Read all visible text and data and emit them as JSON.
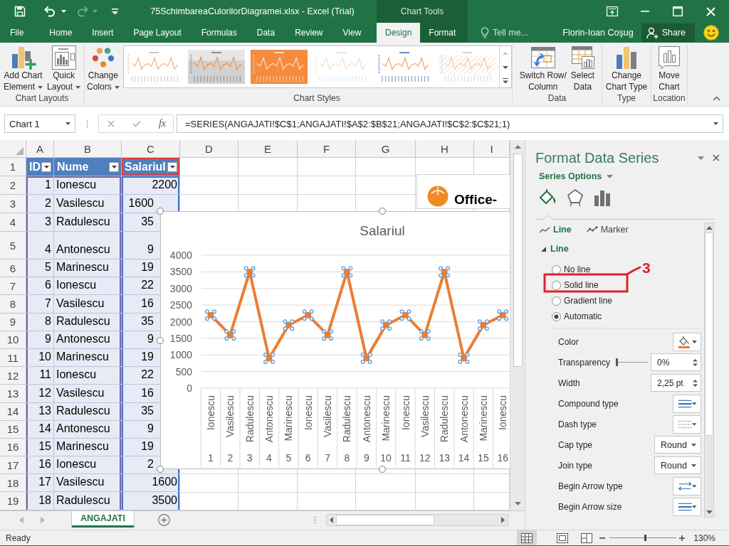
{
  "window": {
    "title": "75SchimbareaCulorilorDiagramei.xlsx - Excel (Trial)",
    "context_label": "Chart Tools",
    "user": "Florin-Ioan Coşug",
    "share_button": "Share"
  },
  "quick_access": [
    {
      "disabled": false
    },
    {
      "disabled": false
    },
    {
      "disabled": true
    },
    {
      "disabled": false
    }
  ],
  "tabs": [
    {
      "label": "File",
      "selected": false,
      "contextual": false
    },
    {
      "label": "Home",
      "selected": false,
      "contextual": false
    },
    {
      "label": "Insert",
      "selected": false,
      "contextual": false
    },
    {
      "label": "Page Layout",
      "selected": false,
      "contextual": false
    },
    {
      "label": "Formulas",
      "selected": false,
      "contextual": false
    },
    {
      "label": "Data",
      "selected": false,
      "contextual": false
    },
    {
      "label": "Review",
      "selected": false,
      "contextual": false
    },
    {
      "label": "View",
      "selected": false,
      "contextual": false
    },
    {
      "label": "Design",
      "selected": true,
      "contextual": true
    },
    {
      "label": "Format",
      "selected": false,
      "contextual": true
    }
  ],
  "tell_me": {
    "placeholder": "Tell me..."
  },
  "ribbon": {
    "groups": [
      {
        "label": "Chart Layouts",
        "buttons": [
          {
            "lines": [
              "Add Chart",
              "Element"
            ],
            "dropdown": true
          },
          {
            "lines": [
              "Quick",
              "Layout"
            ],
            "dropdown": true
          }
        ]
      },
      {
        "label": "Chart Styles",
        "buttons": [
          {
            "lines": [
              "Change",
              "Colors"
            ],
            "dropdown": true
          }
        ],
        "gallery": [
          {
            "kind": "plain"
          },
          {
            "kind": "shaded"
          },
          {
            "kind": "filled"
          },
          {
            "kind": "faint"
          },
          {
            "kind": "accented"
          },
          {
            "kind": "hatched"
          }
        ]
      },
      {
        "label": "Data",
        "buttons": [
          {
            "lines": [
              "Switch Row/",
              "Column"
            ],
            "dropdown": false
          },
          {
            "lines": [
              "Select",
              "Data"
            ],
            "dropdown": false
          }
        ]
      },
      {
        "label": "Type",
        "buttons": [
          {
            "lines": [
              "Change",
              "Chart Type"
            ],
            "dropdown": false
          }
        ]
      },
      {
        "label": "Location",
        "buttons": [
          {
            "lines": [
              "Move",
              "Chart"
            ],
            "dropdown": false
          }
        ]
      }
    ]
  },
  "formula_bar": {
    "name_box": "Chart 1",
    "function_label": "fx",
    "formula": "=SERIES(ANGAJATI!$C$1;ANGAJATI!$A$2:$B$21;ANGAJATI!$C$2:$C$21;1)"
  },
  "sheet": {
    "columns": [
      "A",
      "B",
      "C",
      "D",
      "E",
      "F",
      "G",
      "H",
      "I"
    ],
    "rows": [
      {
        "number": "1",
        "kind": "header",
        "cells": [
          "ID",
          "Nume",
          "Salariul"
        ]
      },
      {
        "number": "2",
        "kind": "data",
        "cells": [
          "1",
          "Ionescu",
          "2200"
        ]
      },
      {
        "number": "3",
        "kind": "data",
        "cells": [
          "2",
          "Vasilescu",
          "1600"
        ]
      },
      {
        "number": "4",
        "kind": "data",
        "cells": [
          "3",
          "Radulescu",
          "35"
        ]
      },
      {
        "number": "5",
        "kind": "data",
        "cells": [
          "4",
          "Antonescu",
          "9"
        ]
      },
      {
        "number": "6",
        "kind": "data",
        "cells": [
          "5",
          "Marinescu",
          "19"
        ]
      },
      {
        "number": "7",
        "kind": "data",
        "cells": [
          "6",
          "Ionescu",
          "22"
        ]
      },
      {
        "number": "8",
        "kind": "data",
        "cells": [
          "7",
          "Vasilescu",
          "16"
        ]
      },
      {
        "number": "9",
        "kind": "data",
        "cells": [
          "8",
          "Radulescu",
          "35"
        ]
      },
      {
        "number": "10",
        "kind": "data",
        "cells": [
          "9",
          "Antonescu",
          "9"
        ]
      },
      {
        "number": "11",
        "kind": "data",
        "cells": [
          "10",
          "Marinescu",
          "19"
        ]
      },
      {
        "number": "12",
        "kind": "data",
        "cells": [
          "11",
          "Ionescu",
          "22"
        ]
      },
      {
        "number": "13",
        "kind": "data",
        "cells": [
          "12",
          "Vasilescu",
          "16"
        ]
      },
      {
        "number": "14",
        "kind": "data",
        "cells": [
          "13",
          "Radulescu",
          "35"
        ]
      },
      {
        "number": "15",
        "kind": "data",
        "cells": [
          "14",
          "Antonescu",
          "9"
        ]
      },
      {
        "number": "16",
        "kind": "data",
        "cells": [
          "15",
          "Marinescu",
          "19"
        ]
      },
      {
        "number": "17",
        "kind": "data",
        "cells": [
          "16",
          "Ionescu",
          "2"
        ]
      },
      {
        "number": "18",
        "kind": "data",
        "cells": [
          "17",
          "Vasilescu",
          "1600"
        ]
      },
      {
        "number": "19",
        "kind": "data",
        "cells": [
          "18",
          "Radulescu",
          "3500"
        ]
      }
    ],
    "picture": {
      "text": "Office-"
    },
    "chart": {
      "selected": true,
      "category_ids": [
        "1",
        "2",
        "3",
        "4",
        "5",
        "6",
        "7",
        "8",
        "9",
        "10",
        "11",
        "12",
        "13",
        "14",
        "15",
        "16"
      ],
      "chart_data": {
        "type": "line",
        "title": "Salariul",
        "grid": true,
        "categories": [
          "Ionescu",
          "Vasilescu",
          "Radulescu",
          "Antonescu",
          "Marinescu",
          "Ionescu",
          "Vasilescu",
          "Radulescu",
          "Antonescu",
          "Marinescu",
          "Ionescu",
          "Vasilescu",
          "Radulescu",
          "Antonescu",
          "Marinescu",
          "Ionescu"
        ],
        "series": [
          {
            "color": "#ed7d31",
            "marker": true,
            "values": [
              2200,
              1600,
              3500,
              900,
              1900,
              2200,
              1600,
              3500,
              900,
              1900,
              2200,
              1600,
              3500,
              900,
              1900,
              2200
            ]
          }
        ],
        "ylim": [
          0,
          4000
        ],
        "yticks": [
          0,
          500,
          1000,
          1500,
          2000,
          2500,
          3000,
          3500,
          4000
        ]
      }
    }
  },
  "pane": {
    "title": "Format Data Series",
    "options_label": "Series Options",
    "icon_tabs": [
      {
        "selected": true
      },
      {
        "selected": false
      },
      {
        "selected": false
      }
    ],
    "subtabs": [
      {
        "label": "Line",
        "selected": true
      },
      {
        "label": "Marker",
        "selected": false
      }
    ],
    "section": {
      "label": "Line",
      "expanded": true
    },
    "line_options": [
      {
        "label": "No line",
        "selected": false
      },
      {
        "label": "Solid line",
        "selected": false,
        "annotation": "3"
      },
      {
        "label": "Gradient line",
        "selected": false
      },
      {
        "label": "Automatic",
        "selected": true
      }
    ],
    "properties": [
      {
        "kind": "color",
        "label": "Color"
      },
      {
        "kind": "slider",
        "label": "Transparency",
        "level": 0,
        "value": "0%"
      },
      {
        "kind": "spinner",
        "label": "Width",
        "value": "2,25 pt"
      },
      {
        "kind": "lines",
        "label": "Compound type"
      },
      {
        "kind": "dashes",
        "label": "Dash type"
      },
      {
        "kind": "dropdown",
        "label": "Cap type",
        "value": "Round"
      },
      {
        "kind": "dropdown",
        "label": "Join type",
        "value": "Round"
      },
      {
        "kind": "arrows",
        "label": "Begin Arrow type"
      },
      {
        "kind": "lines",
        "label": "Begin Arrow size"
      }
    ]
  },
  "sheet_tabs": [
    {
      "label": "ANGAJATI",
      "selected": true
    }
  ],
  "status_bar": {
    "text": "Ready",
    "views": [
      {
        "selected": true
      },
      {
        "selected": false
      },
      {
        "selected": false
      }
    ],
    "zoom": {
      "level": 0.53,
      "label": "130%"
    }
  }
}
